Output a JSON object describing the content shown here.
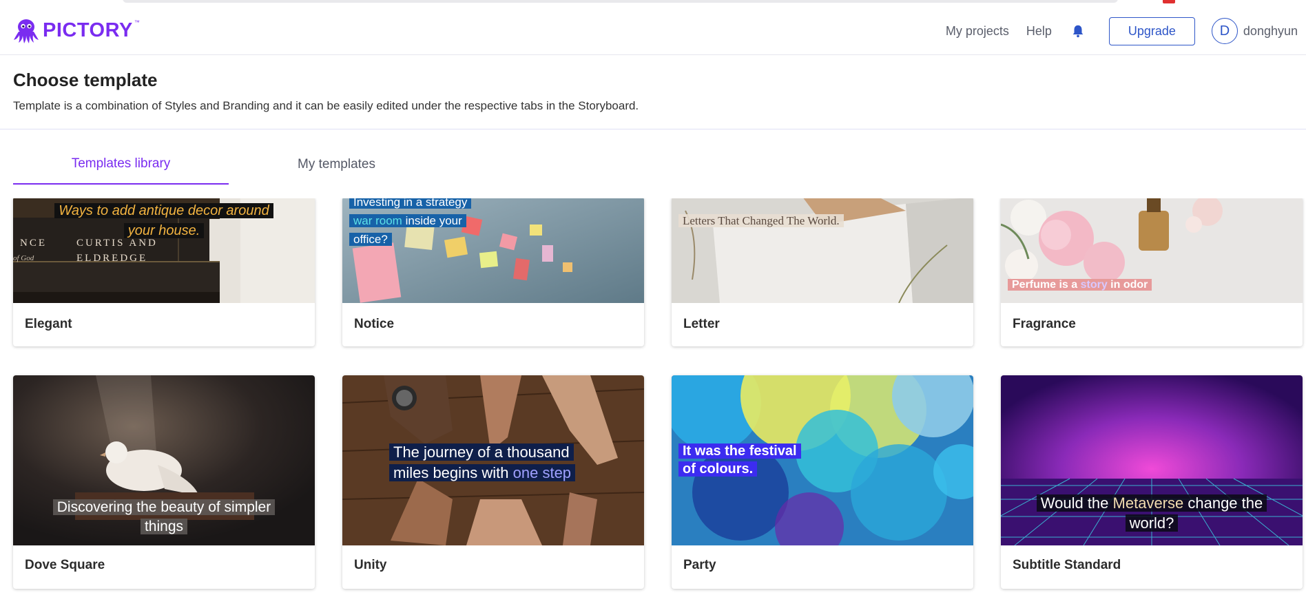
{
  "app": {
    "name": "PICTORY",
    "trademark": "™"
  },
  "nav": {
    "my_projects": "My projects",
    "help": "Help",
    "upgrade": "Upgrade",
    "avatar_initial": "D",
    "username": "donghyun"
  },
  "page": {
    "title": "Choose template",
    "subtitle": "Template is a combination of Styles and Branding and it can be easily edited under the respective tabs in the Storyboard."
  },
  "tabs": [
    {
      "label": "Templates library",
      "active": true
    },
    {
      "label": "My templates",
      "active": false
    }
  ],
  "templates": [
    {
      "name": "Elegant",
      "caption_lines": [
        "Ways to add antique decor around",
        "your house."
      ],
      "book_text": [
        "NCE",
        "CURTIS AND",
        "of God",
        "ELDREDGE"
      ]
    },
    {
      "name": "Notice",
      "caption_parts": [
        "Investing in a strategy",
        "war room",
        " inside your",
        "office?"
      ]
    },
    {
      "name": "Letter",
      "caption": "Letters That Changed The World."
    },
    {
      "name": "Fragrance",
      "caption_parts": [
        "Perfume is a ",
        "story",
        " in odor"
      ]
    },
    {
      "name": "Dove Square",
      "caption_lines": [
        "Discovering the beauty of simpler",
        "things"
      ]
    },
    {
      "name": "Unity",
      "caption_parts": [
        "The journey of a thousand",
        "miles begins with ",
        "one step"
      ]
    },
    {
      "name": "Party",
      "caption_lines": [
        "It was the festival",
        "of colours."
      ]
    },
    {
      "name": "Subtitle Standard",
      "caption_parts": [
        "Would the ",
        "Metaverse",
        " change the",
        "world?"
      ]
    }
  ],
  "colors": {
    "brand": "#7a2cf0",
    "link_blue": "#2d55c8"
  }
}
